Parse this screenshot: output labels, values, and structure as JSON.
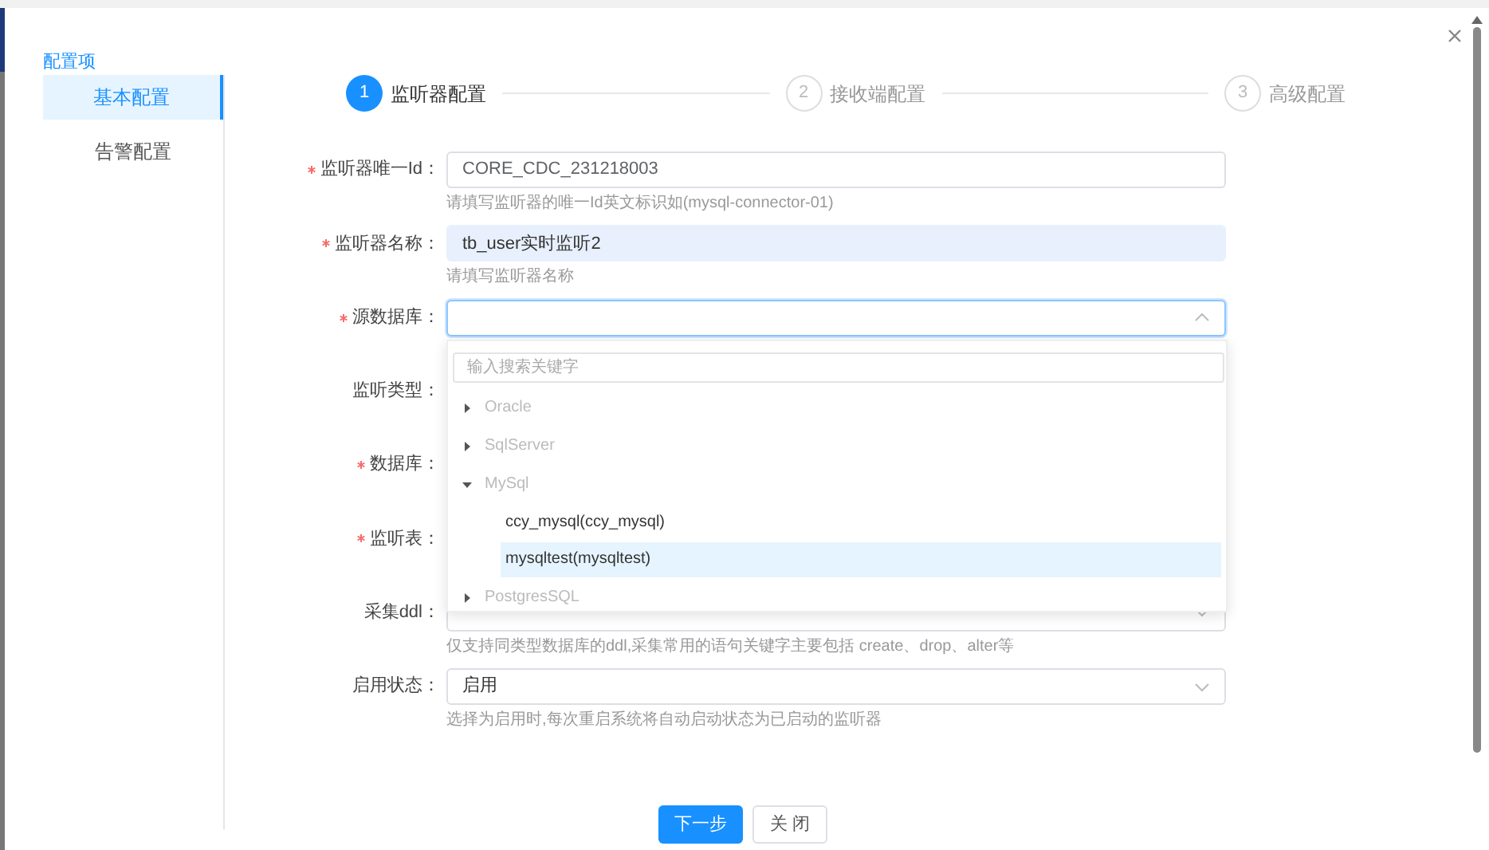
{
  "sidebar": {
    "title": "配置项",
    "items": [
      {
        "label": "基本配置",
        "selected": true
      },
      {
        "label": "告警配置",
        "selected": false
      }
    ]
  },
  "steps": [
    {
      "number": "1",
      "title": "监听器配置",
      "active": true
    },
    {
      "number": "2",
      "title": "接收端配置",
      "active": false
    },
    {
      "number": "3",
      "title": "高级配置",
      "active": false
    }
  ],
  "form": {
    "fields": [
      {
        "label": "监听器唯一Id：",
        "required": true,
        "kind": "input",
        "value": "CORE_CDC_231218003",
        "autofilled": false,
        "hint": "请填写监听器的唯一Id英文标识如(mysql-connector-01)"
      },
      {
        "label": "监听器名称：",
        "required": true,
        "kind": "input",
        "value": "tb_user实时监听2",
        "autofilled": true,
        "hint": "请填写监听器名称"
      },
      {
        "label": "源数据库：",
        "required": true,
        "kind": "select",
        "open": true
      },
      {
        "label": "监听类型：",
        "required": false
      },
      {
        "label": "数据库：",
        "required": true
      },
      {
        "label": "监听表：",
        "required": true
      },
      {
        "label": "采集ddl：",
        "required": false,
        "kind": "select",
        "open": false,
        "hint": "仅支持同类型数据库的ddl,采集常用的语句关键字主要包括 create、drop、alter等"
      },
      {
        "label": "启用状态：",
        "required": false,
        "kind": "select",
        "value": "启用",
        "open": false,
        "hint": "选择为启用时,每次重启系统将自动启动状态为已启动的监听器"
      }
    ]
  },
  "dropdown": {
    "search_placeholder": "输入搜索关键字",
    "tree": [
      {
        "label": "Oracle",
        "expanded": false
      },
      {
        "label": "SqlServer",
        "expanded": false
      },
      {
        "label": "MySql",
        "expanded": true,
        "children": [
          {
            "label": "ccy_mysql(ccy_mysql)",
            "selected": false
          },
          {
            "label": "mysqltest(mysqltest)",
            "selected": true
          }
        ]
      },
      {
        "label": "PostgresSQL",
        "expanded": false
      }
    ]
  },
  "buttons": [
    {
      "label": "下一步",
      "kind": "primary"
    },
    {
      "label": "关 闭",
      "kind": "default"
    }
  ]
}
